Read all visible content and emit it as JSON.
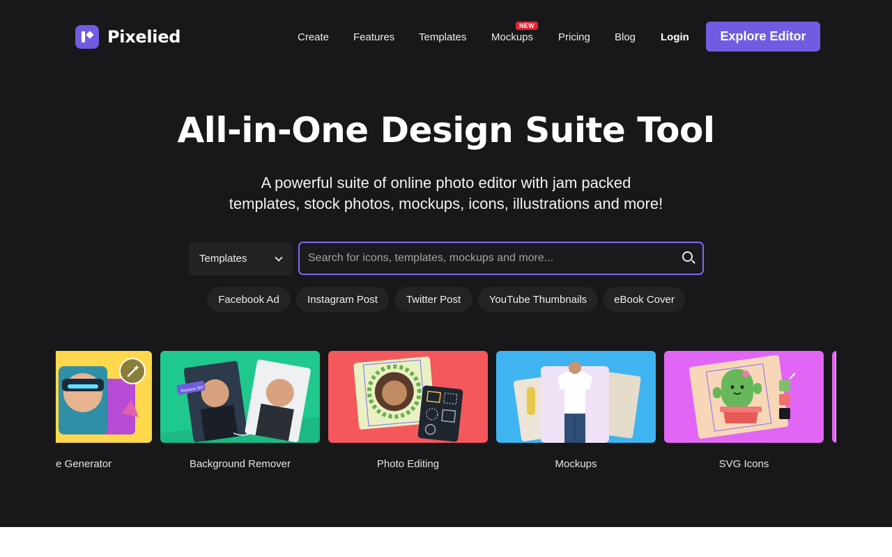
{
  "brand": {
    "name": "Pixelied",
    "accent": "#6f5ce0",
    "badge_color": "#e5232f"
  },
  "nav": {
    "items": [
      "Create",
      "Features",
      "Templates",
      "Mockups",
      "Pricing",
      "Blog"
    ],
    "new_badge": "NEW",
    "login": "Login",
    "cta": "Explore Editor"
  },
  "hero": {
    "title": "All-in-One Design Suite Tool",
    "subtitle_line1": "A powerful suite of online photo editor with jam packed",
    "subtitle_line2": "templates, stock photos, mockups, icons, illustrations and more!"
  },
  "search": {
    "category": "Templates",
    "placeholder": "Search for icons, templates, mockups and more..."
  },
  "chips": [
    "Facebook Ad",
    "Instagram Post",
    "Twitter Post",
    "YouTube Thumbnails",
    "eBook Cover"
  ],
  "cards": [
    {
      "label": "Image Generator",
      "color": "#ffd84d",
      "icon": "magic-wand-icon"
    },
    {
      "label": "Background Remover",
      "color": "#1fc98e",
      "tag": "Remove BG"
    },
    {
      "label": "Photo Editing",
      "color": "#f5585c"
    },
    {
      "label": "Mockups",
      "color": "#3fb4f0"
    },
    {
      "label": "SVG Icons",
      "color": "#e266f5"
    }
  ]
}
